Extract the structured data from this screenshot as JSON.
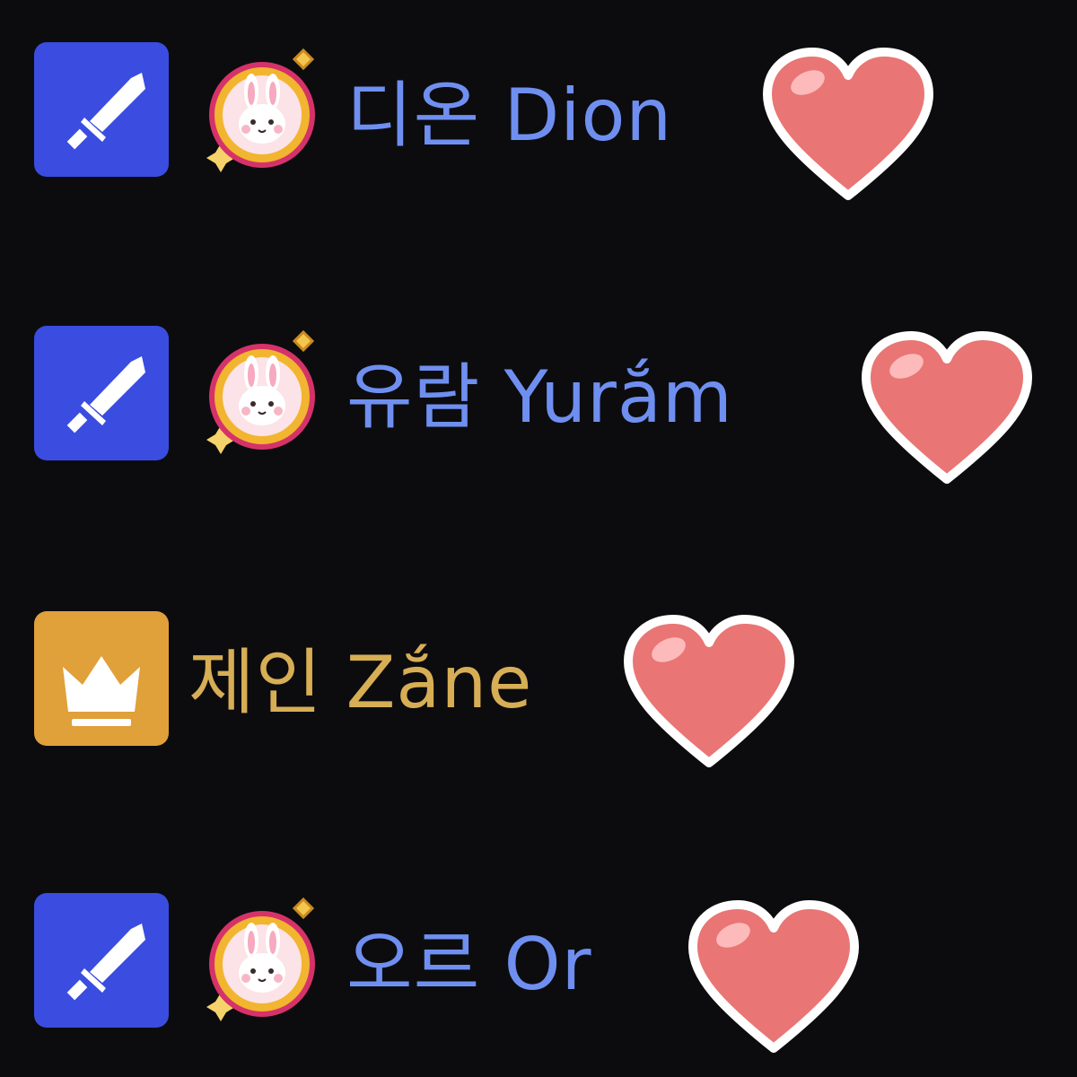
{
  "colors": {
    "background": "#0c0c0f",
    "member_name": "#6f8ff0",
    "leader_name": "#d7ae55",
    "sword_tile": "#3a4de0",
    "crown_tile": "#e0a03a",
    "heart_fill": "#e97575",
    "heart_outline": "#ffffff",
    "badge_ring": "#f2b52f"
  },
  "members": [
    {
      "name": "디온 Dion",
      "role_icon": "sword-icon",
      "badge_icon": "bunny-badge-icon",
      "reaction_icon": "heart-icon"
    },
    {
      "name": "유람 Yurắm",
      "role_icon": "sword-icon",
      "badge_icon": "bunny-badge-icon",
      "reaction_icon": "heart-icon"
    },
    {
      "name": "제인 Zắne",
      "role_icon": "crown-icon",
      "reaction_icon": "heart-icon"
    },
    {
      "name": "오르 Or",
      "role_icon": "sword-icon",
      "badge_icon": "bunny-badge-icon",
      "reaction_icon": "heart-icon"
    }
  ]
}
